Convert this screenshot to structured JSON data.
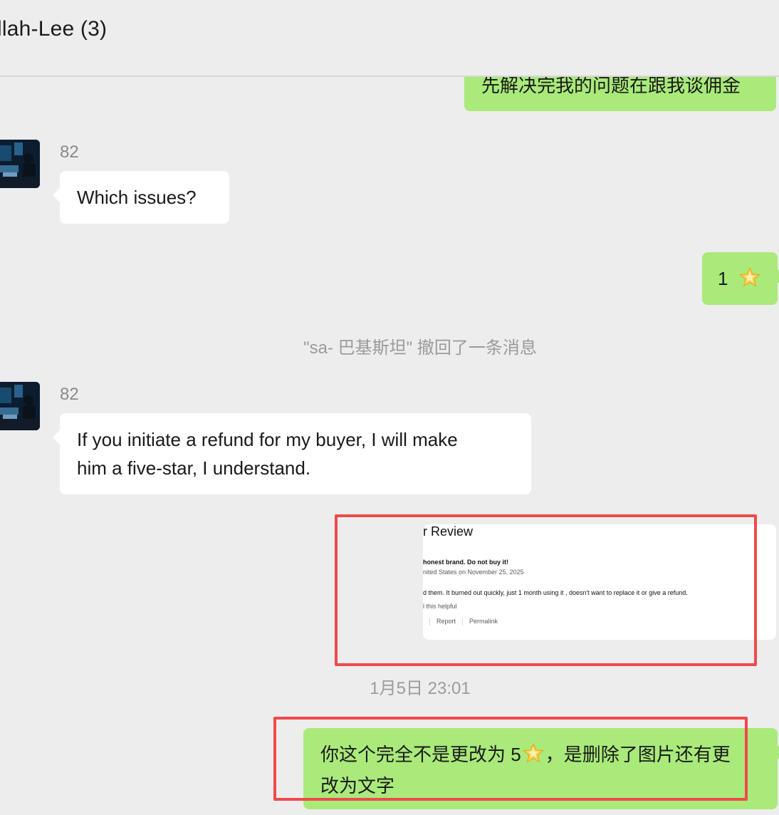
{
  "header": {
    "title": "llah-Lee (3)"
  },
  "messages": [
    {
      "id": "m1",
      "direction": "outgoing",
      "text": "先解决完我的问题在跟我谈佣金"
    },
    {
      "id": "m2",
      "direction": "incoming",
      "sender": "82",
      "text": "Which issues?"
    },
    {
      "id": "m3",
      "direction": "outgoing",
      "text": "1",
      "emoji": "star-emoji"
    },
    {
      "id": "m4",
      "direction": "incoming",
      "sender": "82",
      "text_lines": [
        "If you initiate a refund for my buyer, I will make",
        "him a five-star, I understand."
      ]
    },
    {
      "id": "m5",
      "direction": "outgoing",
      "type": "image",
      "review": {
        "title": "r Review",
        "headline": "honest brand. Do not buy it!",
        "meta": "nited States on November 25, 2025",
        "body": "d them. It burned out quickly, just 1 month using it , doesn't want to replace it or give a refund.",
        "helpful": "l this helpful",
        "actions": [
          "Report",
          "Permalink"
        ]
      }
    },
    {
      "id": "m6",
      "direction": "outgoing",
      "text_parts": [
        "你这个完全不是更改为 5",
        "，是删除了图片还有更",
        "改为文字"
      ],
      "emoji": "star-emoji"
    }
  ],
  "system_note": "\"sa- 巴基斯坦\" 撤回了一条消息",
  "timestamp": "1月5日 23:01",
  "colors": {
    "outgoing_bubble": "#a9ea7a",
    "incoming_bubble": "#ffffff",
    "background": "#ededed",
    "annotation_box": "#f0494b"
  }
}
